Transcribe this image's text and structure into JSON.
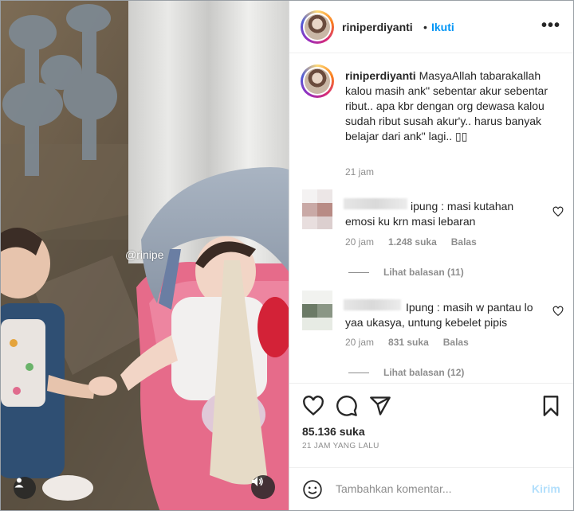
{
  "media": {
    "watermark": "@rinipe",
    "icons": {
      "user_tag": "person-icon",
      "sound": "speaker-icon"
    }
  },
  "header": {
    "username": "riniperdiyanti",
    "separator": "•",
    "follow_label": "Ikuti",
    "more_label": "•••"
  },
  "caption": {
    "username": "riniperdiyanti",
    "text": "MasyaAllah tabarakallah kalou masih ank\" sebentar akur sebentar ribut.. apa kbr dengan org dewasa kalou sudah ribut susah akur'y.. harus banyak belajar dari ank\" lagi.. ▯▯",
    "time": "21 jam"
  },
  "comments": [
    {
      "text": "ipung : masi kutahan emosi ku krn masi lebaran",
      "time": "20 jam",
      "likes": "1.248 suka",
      "reply_label": "Balas",
      "view_replies": "Lihat balasan (11)"
    },
    {
      "text": "Ipung : masih w pantau lo yaa ukasya, untung kebelet pipis",
      "time": "20 jam",
      "likes": "831 suka",
      "reply_label": "Balas",
      "view_replies": "Lihat balasan (12)"
    }
  ],
  "actions": {
    "likes": "85.136 suka",
    "posted": "21 JAM YANG LALU"
  },
  "add_comment": {
    "placeholder": "Tambahkan komentar...",
    "post_label": "Kirim"
  },
  "colors": {
    "accent": "#0095f6",
    "muted": "#8e8e8e",
    "post_disabled": "#b2dffc"
  }
}
